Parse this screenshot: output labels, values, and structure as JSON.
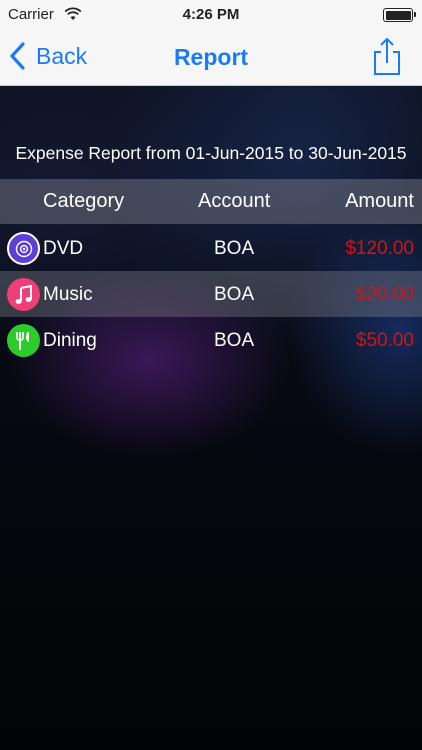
{
  "status_bar": {
    "carrier": "Carrier",
    "time": "4:26 PM"
  },
  "nav": {
    "back_label": "Back",
    "title": "Report",
    "share_icon": "share-icon"
  },
  "report": {
    "title": "Expense Report from 01-Jun-2015 to 30-Jun-2015"
  },
  "table": {
    "headers": {
      "category": "Category",
      "account": "Account",
      "amount": "Amount"
    },
    "rows": [
      {
        "icon": "dvd-icon",
        "icon_color": "#5b3fd8",
        "category": "DVD",
        "account": "BOA",
        "amount": "$120.00"
      },
      {
        "icon": "music-note-icon",
        "icon_color": "#ef3e78",
        "category": "Music",
        "account": "BOA",
        "amount": "$20.00"
      },
      {
        "icon": "fork-knife-icon",
        "icon_color": "#2bcc2b",
        "category": "Dining",
        "account": "BOA",
        "amount": "$50.00"
      }
    ]
  },
  "colors": {
    "accent": "#1a7cf5",
    "amount": "#d11414"
  }
}
